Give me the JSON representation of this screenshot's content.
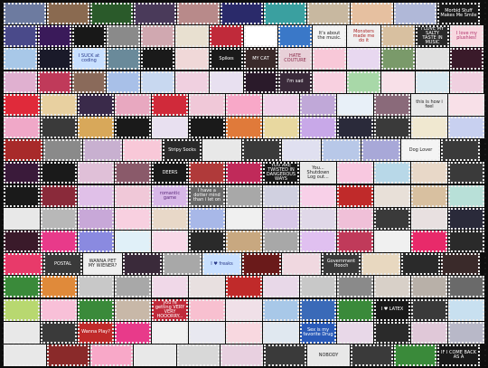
{
  "page": {
    "title": ""
  },
  "rows": [
    {
      "stamps": [
        {
          "t": "",
          "c": "#6d7ba0"
        },
        {
          "t": "",
          "c": "#8a6a50"
        },
        {
          "t": "",
          "c": "#2a5a2a"
        },
        {
          "t": "",
          "c": "#4a3a5a"
        },
        {
          "t": "",
          "c": "#b88a8a"
        },
        {
          "t": "",
          "c": "#2a2a6a"
        },
        {
          "t": "",
          "c": "#3aa0a0"
        },
        {
          "t": "",
          "c": "#c8b8a0"
        },
        {
          "t": "",
          "c": "#e6c0a0"
        },
        {
          "t": "",
          "c": "#b0b8d8"
        },
        {
          "t": "Morbid Stuff Makes Me Smile",
          "c": "#1a1a1a",
          "fc": "#ffffff"
        }
      ]
    },
    {
      "stamps": [
        {
          "t": "",
          "c": "#4a4a8a"
        },
        {
          "t": "",
          "c": "#3a1a5a"
        },
        {
          "t": "",
          "c": "#181818",
          "fc": "#ff5a8a"
        },
        {
          "t": "",
          "c": "#8a8a8a"
        },
        {
          "t": "",
          "c": "#d0a8b0"
        },
        {
          "t": "",
          "c": "#e8e0d0"
        },
        {
          "t": "",
          "c": "#c02a3a"
        },
        {
          "t": "",
          "c": "#ffffff",
          "fc": "#222222"
        },
        {
          "t": "",
          "c": "#3a78c8"
        },
        {
          "t": "It's about the music.",
          "c": "#f4f4f4",
          "fc": "#222222"
        },
        {
          "t": "Monsters made me do it",
          "c": "#f0f0f0",
          "fc": "#aa2222"
        },
        {
          "t": "",
          "c": "#d8c0a0"
        },
        {
          "t": "I LOVE MY SALTY TASTE IN MUSIC",
          "c": "#2a2a2a",
          "fc": "#ffffff"
        },
        {
          "t": "I love my plushies!",
          "c": "#f8d8e0",
          "fc": "#b0306a"
        }
      ]
    },
    {
      "stamps": [
        {
          "t": "",
          "c": "#a8c8e8"
        },
        {
          "t": "",
          "c": "#1a1a2a"
        },
        {
          "t": "I SUCK at coding",
          "c": "#c8e0ff",
          "fc": "#2a3a8a"
        },
        {
          "t": "",
          "c": "#6a8a9a"
        },
        {
          "t": "",
          "c": "#1a1a1a"
        },
        {
          "t": "",
          "c": "#f0d8d8"
        },
        {
          "t": "Spikes",
          "c": "#1a1a1a",
          "fc": "#ffffff"
        },
        {
          "t": "MY CAT",
          "c": "#3a2a2a",
          "fc": "#ffffff"
        },
        {
          "t": "HATE COUTURE",
          "c": "#e8d0d8",
          "fc": "#8a2a4a"
        },
        {
          "t": "",
          "c": "#f8c8d8"
        },
        {
          "t": "",
          "c": "#e8d8f0"
        },
        {
          "t": "",
          "c": "#7a9a6a"
        },
        {
          "t": "",
          "c": "#e0e0e0"
        },
        {
          "t": "",
          "c": "#3a1a2a"
        }
      ]
    },
    {
      "stamps": [
        {
          "t": "",
          "c": "#e0b0d0"
        },
        {
          "t": "",
          "c": "#c03a5a"
        },
        {
          "t": "",
          "c": "#8a6a5a"
        },
        {
          "t": "",
          "c": "#a8c0e8"
        },
        {
          "t": "",
          "c": "#c8d8f0"
        },
        {
          "t": "",
          "c": "#f0d0e0"
        },
        {
          "t": "",
          "c": "#e8e0f0"
        },
        {
          "t": "",
          "c": "#2a1a2a"
        },
        {
          "t": "I'm sad",
          "c": "#3a2a3a",
          "fc": "#ffffff"
        },
        {
          "t": "",
          "c": "#f8d0e0"
        },
        {
          "t": "",
          "c": "#a8d8a8"
        },
        {
          "t": "",
          "c": "#f8e0e8"
        },
        {
          "t": "",
          "c": "#d8e8f0"
        },
        {
          "t": "",
          "c": "#f0d0e0"
        }
      ]
    },
    {
      "stamps": [
        {
          "t": "",
          "c": "#e02a3a"
        },
        {
          "t": "",
          "c": "#e8d0a0"
        },
        {
          "t": "",
          "c": "#3a2a4a"
        },
        {
          "t": "",
          "c": "#e8a8c0"
        },
        {
          "t": "",
          "c": "#d02a3a"
        },
        {
          "t": "",
          "c": "#f0c8d8"
        },
        {
          "t": "",
          "c": "#f8a8c8"
        },
        {
          "t": "",
          "c": "#f0d0e8"
        },
        {
          "t": "",
          "c": "#c0a8d8"
        },
        {
          "t": "",
          "c": "#e8f0f8"
        },
        {
          "t": "",
          "c": "#8a6a7a"
        },
        {
          "t": "this is how i feel",
          "c": "#e8e8e8",
          "fc": "#222222"
        },
        {
          "t": "",
          "c": "#f8e0e8"
        }
      ]
    },
    {
      "stamps": [
        {
          "t": "",
          "c": "#f0a8c8"
        },
        {
          "t": "",
          "c": "#3a3a3a"
        },
        {
          "t": "",
          "c": "#d8a85a"
        },
        {
          "t": "",
          "c": "#1a1a1a"
        },
        {
          "t": "",
          "c": "#e8e0f0"
        },
        {
          "t": "",
          "c": "#1a1a1a"
        },
        {
          "t": "",
          "c": "#e07a3a"
        },
        {
          "t": "",
          "c": "#e8d8a0"
        },
        {
          "t": "",
          "c": "#c8a8e8"
        },
        {
          "t": "",
          "c": "#2a2a3a"
        },
        {
          "t": "",
          "c": "#3a3a3a"
        },
        {
          "t": "",
          "c": "#f0e8d0"
        },
        {
          "t": "",
          "c": "#c8d0f0"
        }
      ]
    },
    {
      "stamps": [
        {
          "t": "",
          "c": "#a82a2a"
        },
        {
          "t": "",
          "c": "#8a8a8a"
        },
        {
          "t": "",
          "c": "#c8b0d0"
        },
        {
          "t": "",
          "c": "#f8c8d8"
        },
        {
          "t": "Stripy Socks",
          "c": "#2a2a2a",
          "fc": "#ffffff"
        },
        {
          "t": "",
          "c": "#e8e8e8"
        },
        {
          "t": "",
          "c": "#3a3a3a"
        },
        {
          "t": "",
          "c": "#e0e0f0"
        },
        {
          "t": "",
          "c": "#b8c8e8"
        },
        {
          "t": "",
          "c": "#a8a8d8"
        },
        {
          "t": "Dog Lover",
          "c": "#f4f4f4",
          "fc": "#222222"
        },
        {
          "t": "",
          "c": "#3a3a3a"
        }
      ]
    },
    {
      "stamps": [
        {
          "t": "",
          "c": "#3a1a3a"
        },
        {
          "t": "",
          "c": "#1a1a1a"
        },
        {
          "t": "",
          "c": "#e0c0d8"
        },
        {
          "t": "",
          "c": "#8a5a6a"
        },
        {
          "t": "DEERS",
          "c": "#1a1a1a",
          "fc": "#ffffff"
        },
        {
          "t": "",
          "c": "#b03a3a"
        },
        {
          "t": "",
          "c": "#c02a5a"
        },
        {
          "t": "YOU ARE TWISTED IN DANGEROUS WAYS",
          "c": "#1a1a1a",
          "fc": "#ffffff"
        },
        {
          "t": "You... Shutdown Log out...",
          "c": "#e8e8e8",
          "fc": "#222222"
        },
        {
          "t": "",
          "c": "#f8c8e0"
        },
        {
          "t": "",
          "c": "#b8d8e8"
        },
        {
          "t": "",
          "c": "#e8d8c8"
        },
        {
          "t": "",
          "c": "#3a3a3a"
        }
      ]
    },
    {
      "stamps": [
        {
          "t": "",
          "c": "#1a1a1a"
        },
        {
          "t": "",
          "c": "#8a2a3a"
        },
        {
          "t": "",
          "c": "#e0c0e8"
        },
        {
          "t": "",
          "c": "#f0c8d8"
        },
        {
          "t": "romantic game",
          "c": "#d8b8e8",
          "fc": "#5a2a7a"
        },
        {
          "t": "i have a dotter mind than i let on",
          "c": "#6a6a6a",
          "fc": "#ffffff"
        },
        {
          "t": "",
          "c": "#a8a8a8"
        },
        {
          "t": "",
          "c": "#d0d0e0"
        },
        {
          "t": "",
          "c": "#f8d0e8"
        },
        {
          "t": "",
          "c": "#c02a2a"
        },
        {
          "t": "",
          "c": "#e8e0d8"
        },
        {
          "t": "",
          "c": "#d8c0a0"
        },
        {
          "t": "",
          "c": "#b8e0d8"
        }
      ]
    },
    {
      "stamps": [
        {
          "t": "",
          "c": "#e8e8e8"
        },
        {
          "t": "",
          "c": "#b8b8b8"
        },
        {
          "t": "",
          "c": "#c8a8d8"
        },
        {
          "t": "",
          "c": "#f8d0e0"
        },
        {
          "t": "",
          "c": "#e8d8c8"
        },
        {
          "t": "",
          "c": "#a8b8e8"
        },
        {
          "t": "",
          "c": "#f0f0f0"
        },
        {
          "t": "",
          "c": "#d8c8e8"
        },
        {
          "t": "",
          "c": "#e0d8e8"
        },
        {
          "t": "",
          "c": "#f0c0d8"
        },
        {
          "t": "",
          "c": "#3a3a3a"
        },
        {
          "t": "",
          "c": "#e8e0e0"
        },
        {
          "t": "",
          "c": "#2a2a3a"
        }
      ]
    },
    {
      "stamps": [
        {
          "t": "",
          "c": "#3a1a2a"
        },
        {
          "t": "",
          "c": "#e83a8a"
        },
        {
          "t": "",
          "c": "#8a8ae0"
        },
        {
          "t": "",
          "c": "#e0f0f8"
        },
        {
          "t": "",
          "c": "#f8d8e8"
        },
        {
          "t": "",
          "c": "#2a2a2a"
        },
        {
          "t": "",
          "c": "#c8a880"
        },
        {
          "t": "",
          "c": "#a8a8a8"
        },
        {
          "t": "",
          "c": "#e0c0f0"
        },
        {
          "t": "",
          "c": "#c03a5a"
        },
        {
          "t": "",
          "c": "#f0f0f0"
        },
        {
          "t": "",
          "c": "#e82a6a"
        },
        {
          "t": "",
          "c": "#2a2a2a"
        }
      ]
    },
    {
      "stamps": [
        {
          "t": "",
          "c": "#e83a6a"
        },
        {
          "t": "POSTAL",
          "c": "#3a3a3a",
          "fc": "#ffffff"
        },
        {
          "t": "WANNA PET MY WIENER?",
          "c": "#f0f0f0",
          "fc": "#222222"
        },
        {
          "t": "",
          "c": "#3a2a3a"
        },
        {
          "t": "",
          "c": "#a8a8a8"
        },
        {
          "t": "I ♥ freaks",
          "c": "#c8e0ff",
          "fc": "#2a3a8a"
        },
        {
          "t": "",
          "c": "#6a1a1a"
        },
        {
          "t": "",
          "c": "#f0d8e0"
        },
        {
          "t": "Government Hooch",
          "c": "#3a3a3a",
          "fc": "#ffffff"
        },
        {
          "t": "",
          "c": "#e8d8c0"
        },
        {
          "t": "",
          "c": "#2a2a2a"
        },
        {
          "t": "",
          "c": "#3a2a2a"
        }
      ]
    },
    {
      "stamps": [
        {
          "t": "",
          "c": "#3a8a3a"
        },
        {
          "t": "",
          "c": "#e08a3a"
        },
        {
          "t": "",
          "c": "#c8c8c8"
        },
        {
          "t": "",
          "c": "#a8a8a8"
        },
        {
          "t": "",
          "c": "#f0d8e8"
        },
        {
          "t": "",
          "c": "#e8e0e0"
        },
        {
          "t": "",
          "c": "#c02a2a"
        },
        {
          "t": "",
          "c": "#e8d8e8"
        },
        {
          "t": "",
          "c": "#c8c8c8"
        },
        {
          "t": "",
          "c": "#8a8a8a"
        },
        {
          "t": "",
          "c": "#d8d0c8"
        },
        {
          "t": "",
          "c": "#b8b0a8"
        },
        {
          "t": "",
          "c": "#6a6a6a"
        }
      ]
    },
    {
      "stamps": [
        {
          "t": "",
          "c": "#b8d870"
        },
        {
          "t": "",
          "c": "#f8c0d8"
        },
        {
          "t": "",
          "c": "#3a8a3a"
        },
        {
          "t": "",
          "c": "#c8b8a8"
        },
        {
          "t": "you're getting VERY VERY HOOORRY...",
          "c": "#c02a3a",
          "fc": "#ffffff"
        },
        {
          "t": "",
          "c": "#f8c0d0"
        },
        {
          "t": "",
          "c": "#f0e0e8"
        },
        {
          "t": "",
          "c": "#a8c8e8"
        },
        {
          "t": "",
          "c": "#3a6ab8"
        },
        {
          "t": "",
          "c": "#3a8a3a"
        },
        {
          "t": "I ♥ LATEX",
          "c": "#1a1a1a",
          "fc": "#ffffff"
        },
        {
          "t": "",
          "c": "#3a3a3a"
        },
        {
          "t": "",
          "c": "#c8e0f0"
        }
      ]
    },
    {
      "stamps": [
        {
          "t": "",
          "c": "#e8e8e8"
        },
        {
          "t": "",
          "c": "#3a3a3a"
        },
        {
          "t": "Wanna Play?",
          "c": "#c02a2a",
          "fc": "#ffffff"
        },
        {
          "t": "",
          "c": "#e83a8a"
        },
        {
          "t": "",
          "c": "#f0f0f0"
        },
        {
          "t": "",
          "c": "#e8e8f0"
        },
        {
          "t": "",
          "c": "#f8d8e0"
        },
        {
          "t": "",
          "c": "#e0e8f0"
        },
        {
          "t": "Sex is my favorite Drug",
          "c": "#2a5ab8",
          "fc": "#ffffff"
        },
        {
          "t": "",
          "c": "#e8d8e8"
        },
        {
          "t": "",
          "c": "#2a2a2a"
        },
        {
          "t": "",
          "c": "#e0c8d8"
        },
        {
          "t": "",
          "c": "#b8b8c8"
        }
      ]
    },
    {
      "stamps": [
        {
          "t": "",
          "c": "#e8e8e8"
        },
        {
          "t": "",
          "c": "#8a2a2a"
        },
        {
          "t": "",
          "c": "#f8a8c8"
        },
        {
          "t": "",
          "c": "#e8e8e8"
        },
        {
          "t": "",
          "c": "#d8d8d8"
        },
        {
          "t": "",
          "c": "#e8d0e0"
        },
        {
          "t": "",
          "c": "#3a3a3a"
        },
        {
          "t": "NOBODY",
          "c": "#e8e8e8",
          "fc": "#222222"
        },
        {
          "t": "",
          "c": "#3a3a3a"
        },
        {
          "t": "",
          "c": "#3a8a3a"
        },
        {
          "t": "IF I COME BACK AS A",
          "c": "#1a1a1a",
          "fc": "#ffffff"
        }
      ]
    }
  ]
}
